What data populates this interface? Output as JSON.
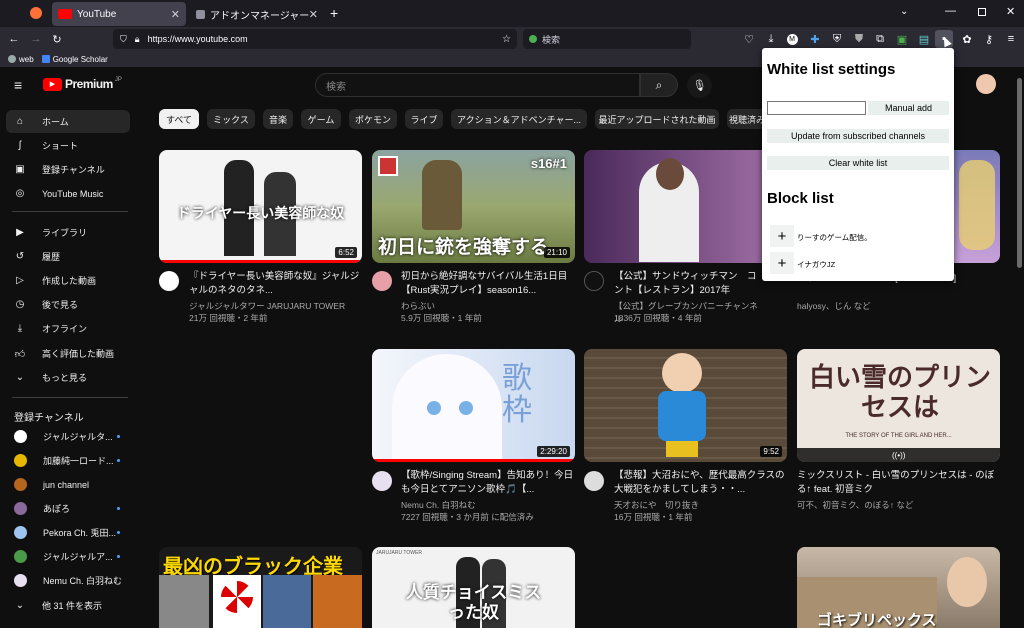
{
  "browser": {
    "tabs": [
      {
        "label": "YouTube",
        "active": true
      },
      {
        "label": "アドオンマネージャー",
        "active": false
      }
    ],
    "url": "https://www.youtube.com",
    "search_placeholder": "検索",
    "bookmarks": [
      "web",
      "Google Scholar"
    ]
  },
  "youtube": {
    "logo_text": "Premium",
    "logo_region": "JP",
    "search_placeholder": "検索",
    "sidebar": {
      "items": [
        {
          "label": "ホーム",
          "icon": "home-icon",
          "active": true
        },
        {
          "label": "ショート",
          "icon": "shorts-icon"
        },
        {
          "label": "登録チャンネル",
          "icon": "subscriptions-icon"
        },
        {
          "label": "YouTube Music",
          "icon": "music-icon"
        },
        {
          "label": "ライブラリ",
          "icon": "library-icon"
        },
        {
          "label": "履歴",
          "icon": "history-icon"
        },
        {
          "label": "作成した動画",
          "icon": "your-videos-icon"
        },
        {
          "label": "後で見る",
          "icon": "watch-later-icon"
        },
        {
          "label": "オフライン",
          "icon": "download-icon"
        },
        {
          "label": "高く評価した動画",
          "icon": "like-icon"
        },
        {
          "label": "もっと見る",
          "icon": "chevron-down-icon"
        }
      ],
      "subs_heading": "登録チャンネル",
      "subs": [
        {
          "label": "ジャルジャルタ...",
          "color": "#ffffff"
        },
        {
          "label": "加藤純一ロード...",
          "color": "#e6b800"
        },
        {
          "label": "jun channel",
          "color": "#b5651d"
        },
        {
          "label": "あぽろ",
          "color": "#8a6a9a"
        },
        {
          "label": "Pekora Ch. 兎田...",
          "color": "#9ec5f0"
        },
        {
          "label": "ジャルジャルア...",
          "color": "#4a9a4a"
        },
        {
          "label": "Nemu Ch. 白羽ねむ",
          "color": "#e8e0f0"
        }
      ],
      "show_more": "他 31 件を表示"
    },
    "chips": [
      "すべて",
      "ミックス",
      "音楽",
      "ゲーム",
      "ポケモン",
      "ライブ",
      "アクション＆アドベンチャー...",
      "最近アップロードされた動画",
      "視聴済み"
    ],
    "videos": [
      {
        "thumb_text": "ドライヤー長い美容師な奴",
        "duration": "6:52",
        "title": "『ドライヤー長い美容師な奴』ジャルジャルのネタのタネ...",
        "channel": "ジャルジャルタワー JARUJARU TOWER",
        "stats": "21万 回視聴・2 年前",
        "bg": "#f4f4f4"
      },
      {
        "thumb_text": "初日に銃を強奪する",
        "thumb_badge": "s16#1",
        "duration": "21:10",
        "title": "初日から絶好調なサバイバル生活1日目【Rust実況プレイ】season16...",
        "channel": "わらぶい",
        "stats": "5.9万 回視聴・1 年前",
        "bg": "#7d8a4a"
      },
      {
        "thumb_text": "",
        "duration": "",
        "title": "【公式】サンドウィッチマン　コント【レストラン】2017年",
        "channel": "【公式】グレープカンパニーチャンネル",
        "stats": "1836万 回視聴・4 年前",
        "bg": "#7a5a8a"
      },
      {
        "thumb_text": "",
        "duration": "",
        "title": "...イン ft. VOCALOIDS [Official Video]",
        "channel": "halyosy、じん など",
        "stats": "",
        "bg": "#6a6aa0"
      },
      {
        "thumb_text": "歌枠",
        "duration": "2:29:20",
        "title": "【歌枠/Singing Stream】告知あり！今日も今日とてアニソン歌枠🎵【...",
        "channel": "Nemu Ch. 白羽ねむ",
        "stats": "7227 回視聴・3 か月前 に配信済み",
        "bg": "#dfe8f4"
      },
      {
        "thumb_text": "",
        "duration": "9:52",
        "title": "【悲報】大沼おにや、歴代最高クラスの大戦犯をかましてしまう・・...",
        "channel": "天才おにや　切り抜き",
        "stats": "16万 回視聴・1 年前",
        "bg": "#6b5b4b"
      },
      {
        "thumb_text": "白い雪のプリンセスは",
        "thumb_sub": "THE STORY OF THE GIRL AND HER...",
        "duration": "",
        "title": "ミックスリスト - 白い雪のプリンセスは - のぼる↑ feat. 初音ミク",
        "channel": "可不、初音ミク、のぼる↑ など",
        "stats": "",
        "bg": "#e8e0d8"
      },
      {
        "thumb_text": "最凶のブラック企業",
        "duration": "",
        "title": "",
        "channel": "",
        "stats": "",
        "bg": "#222222"
      },
      {
        "thumb_text": "人質チョイスミスった奴",
        "thumb_small": "JARUJARU TOWER",
        "duration": "",
        "title": "",
        "channel": "",
        "stats": "",
        "bg": "#eeeeee"
      },
      {
        "thumb_text": "ゴキブリペックス",
        "duration": "",
        "title": "",
        "channel": "",
        "stats": "",
        "bg": "#9a8a7a"
      }
    ]
  },
  "popup": {
    "whitelist_title": "White list settings",
    "manual_add_label": "Manual add",
    "manual_input_value": "",
    "update_label": "Update from subscribed channels",
    "clear_label": "Clear white list",
    "blocklist_title": "Block list",
    "block_items": [
      "りーすのゲーム配信。",
      "イナガウJZ"
    ],
    "plus_label": "+"
  }
}
